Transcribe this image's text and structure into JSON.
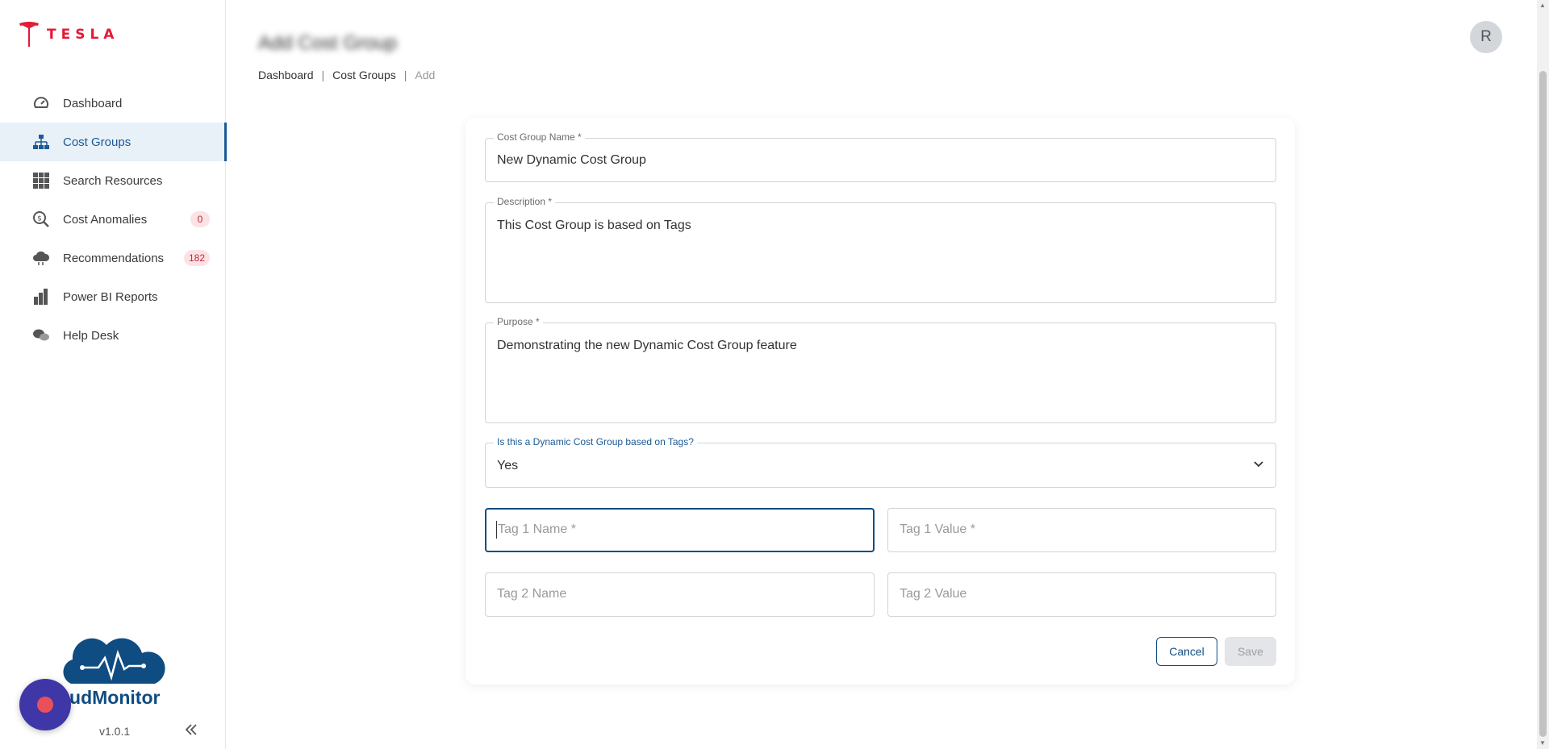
{
  "brand": {
    "name": "TESLA",
    "color": "#e31937"
  },
  "sidebar": {
    "items": [
      {
        "label": "Dashboard",
        "icon": "gauge-icon",
        "active": false
      },
      {
        "label": "Cost Groups",
        "icon": "hierarchy-icon",
        "active": true
      },
      {
        "label": "Search Resources",
        "icon": "grid-icon",
        "active": false
      },
      {
        "label": "Cost Anomalies",
        "icon": "dollar-search-icon",
        "active": false,
        "badge": "0"
      },
      {
        "label": "Recommendations",
        "icon": "cloud-icon",
        "active": false,
        "badge": "182"
      },
      {
        "label": "Power BI Reports",
        "icon": "bar-chart-icon",
        "active": false
      },
      {
        "label": "Help Desk",
        "icon": "chat-bubbles-icon",
        "active": false
      }
    ],
    "product_name": "oudMonitor",
    "version": "v1.0.1"
  },
  "header": {
    "title": "Add Cost Group",
    "breadcrumb": [
      "Dashboard",
      "Cost Groups",
      "Add"
    ],
    "avatar_initial": "R"
  },
  "form": {
    "name": {
      "label": "Cost Group Name *",
      "value": "New Dynamic Cost Group"
    },
    "description": {
      "label": "Description *",
      "value": "This Cost Group is based on Tags"
    },
    "purpose": {
      "label": "Purpose *",
      "value": "Demonstrating the new Dynamic Cost Group feature"
    },
    "dynamic": {
      "label": "Is this a Dynamic Cost Group based on Tags?",
      "value": "Yes"
    },
    "tag1_name": {
      "placeholder": "Tag 1 Name *"
    },
    "tag1_value": {
      "placeholder": "Tag 1 Value *"
    },
    "tag2_name": {
      "placeholder": "Tag 2 Name"
    },
    "tag2_value": {
      "placeholder": "Tag 2 Value"
    },
    "cancel_label": "Cancel",
    "save_label": "Save"
  },
  "colors": {
    "primary": "#0f4c81",
    "active_bg": "#e8f0f8",
    "badge_bg": "#fbe3e5",
    "badge_text": "#c0283c"
  }
}
